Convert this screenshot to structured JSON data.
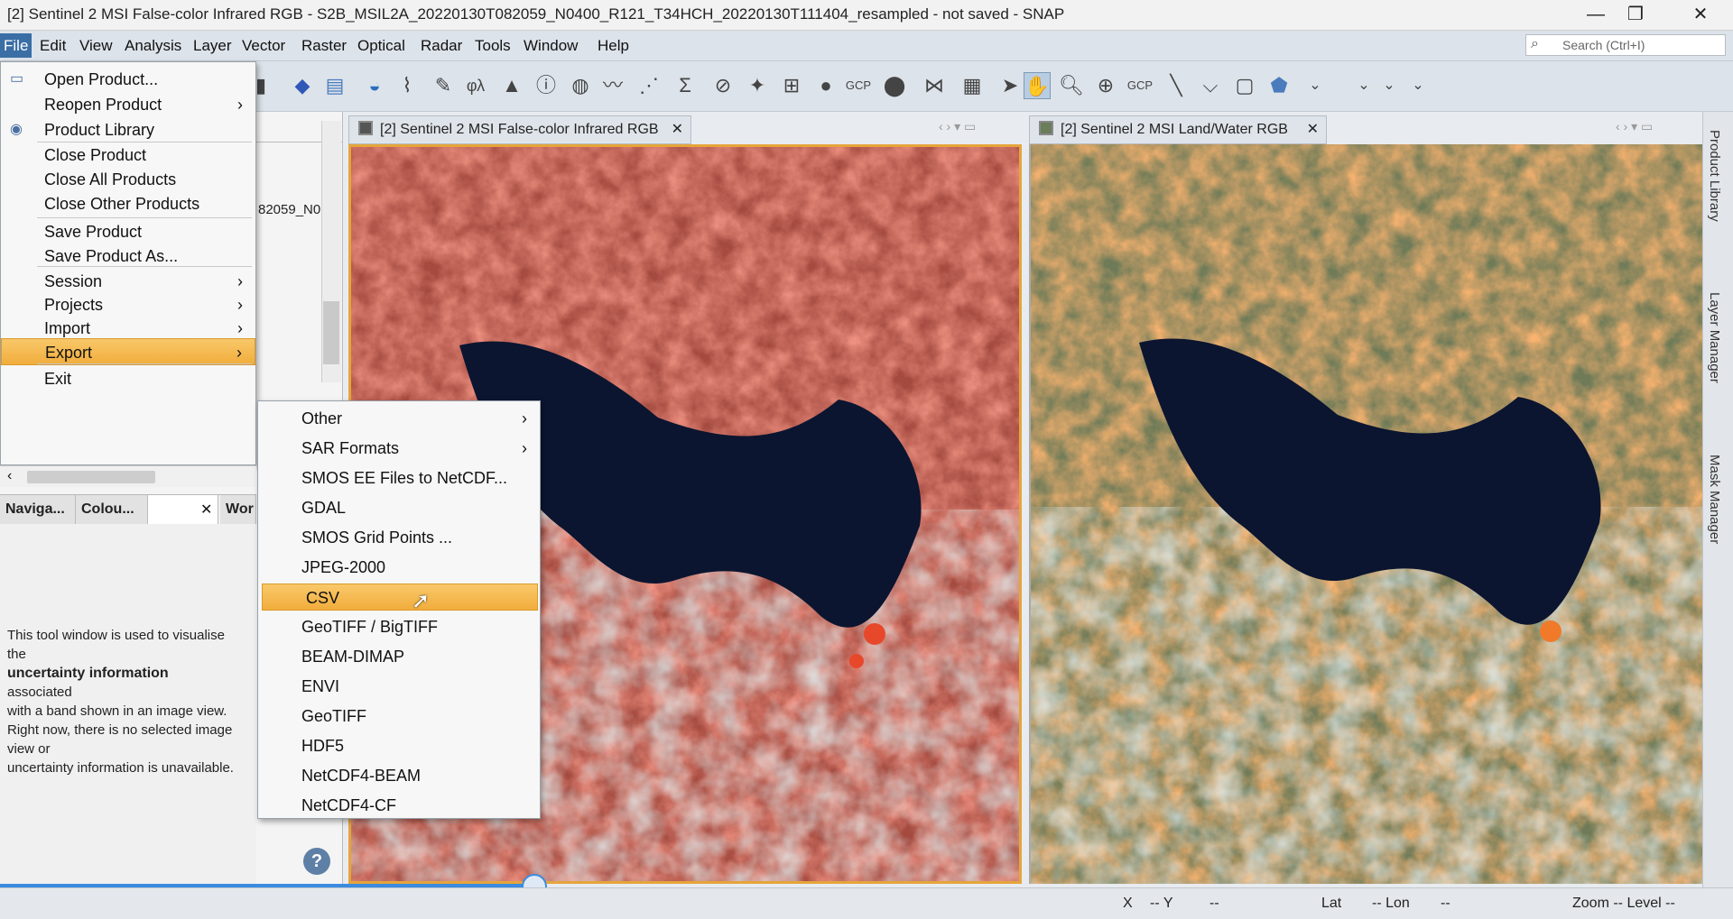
{
  "window": {
    "title": "[2] Sentinel 2 MSI False-color Infrared RGB - S2B_MSIL2A_20220130T082059_N0400_R121_T34HCH_20220130T111404_resampled - not saved - SNAP",
    "minimize": "—",
    "restore": "❐",
    "close": "✕"
  },
  "menubar": [
    "File",
    "Edit",
    "View",
    "Analysis",
    "Layer",
    "Vector",
    "Raster",
    "Optical",
    "Radar",
    "Tools",
    "Window",
    "Help"
  ],
  "search": {
    "placeholder": "Search (Ctrl+I)"
  },
  "toolbar": {
    "icons": [
      "open-product-icon",
      "save-icon",
      "rgb-icon",
      "layer-icon",
      "wave-icon",
      "vector-draw-icon",
      "pencil-icon",
      "spectrum-icon",
      "histogram-icon",
      "information-icon",
      "globe-icon",
      "plot-icon",
      "scatter-icon",
      "sum-icon",
      "crop-icon",
      "magic-icon",
      "grid-icon",
      "mask-icon",
      "gcp-icon",
      "pin-icon",
      "graph-icon",
      "matrix-icon",
      "select-icon",
      "pan-icon",
      "zoom-icon",
      "zoom-plus-icon",
      "gcp-plus-icon",
      "line-icon",
      "polyline-icon",
      "rectangle-icon",
      "shape-icon"
    ],
    "gcp_text": "GCP"
  },
  "left_panel": {
    "product_fragment": "82059_N0",
    "tabs": [
      "Naviga...",
      "Colou...",
      "Wor"
    ],
    "uncertainty_text": [
      {
        "text": "This tool window is used to visualise",
        "bold": false
      },
      {
        "text": "the",
        "bold": false
      },
      {
        "text": "uncertainty information",
        "bold": true
      },
      {
        "text": "associated",
        "bold": false
      },
      {
        "text": "with a band shown in an image view.",
        "bold": false
      },
      {
        "text": "Right now, there is no selected image",
        "bold": false
      },
      {
        "text": "view or",
        "bold": false
      },
      {
        "text": "uncertainty information is unavailable.",
        "bold": false
      }
    ],
    "help": "?"
  },
  "file_menu": {
    "items": [
      {
        "label": "Open Product...",
        "submenu": false,
        "icon": "folder-icon"
      },
      {
        "label": "Reopen Product",
        "submenu": true
      },
      {
        "label": "Product Library",
        "submenu": false,
        "icon": "library-icon"
      },
      {
        "label": "Close Product",
        "submenu": false
      },
      {
        "label": "Close All Products",
        "submenu": false
      },
      {
        "label": "Close Other Products",
        "submenu": false
      },
      {
        "label": "Save Product",
        "submenu": false
      },
      {
        "label": "Save Product As...",
        "submenu": false
      },
      {
        "label": "Session",
        "submenu": true
      },
      {
        "label": "Projects",
        "submenu": true
      },
      {
        "label": "Import",
        "submenu": true
      },
      {
        "label": "Export",
        "submenu": true,
        "highlighted": true
      },
      {
        "label": "Exit",
        "submenu": false
      }
    ]
  },
  "export_menu": {
    "items": [
      {
        "label": "Other",
        "submenu": true
      },
      {
        "label": "SAR Formats",
        "submenu": true
      },
      {
        "label": "SMOS EE Files to NetCDF...",
        "submenu": false
      },
      {
        "label": "GDAL",
        "submenu": false
      },
      {
        "label": "SMOS Grid Points ...",
        "submenu": false
      },
      {
        "label": "JPEG-2000",
        "submenu": false
      },
      {
        "label": "CSV",
        "submenu": false,
        "highlighted": true
      },
      {
        "label": "GeoTIFF / BigTIFF",
        "submenu": false
      },
      {
        "label": "BEAM-DIMAP",
        "submenu": false
      },
      {
        "label": "ENVI",
        "submenu": false
      },
      {
        "label": "GeoTIFF",
        "submenu": false
      },
      {
        "label": "HDF5",
        "submenu": false
      },
      {
        "label": "NetCDF4-BEAM",
        "submenu": false
      },
      {
        "label": "NetCDF4-CF",
        "submenu": false
      }
    ]
  },
  "views": [
    {
      "tab": "[2] Sentinel 2 MSI False-color Infrared RGB",
      "close": "✕"
    },
    {
      "tab": "[2] Sentinel 2 MSI Land/Water RGB",
      "close": "✕"
    }
  ],
  "right_sidebar": [
    "Product Library",
    "Layer Manager",
    "Mask Manager"
  ],
  "statusbar": {
    "x": "X",
    "y": "-- Y",
    "y_val": "--",
    "lat": "Lat",
    "lon": "-- Lon",
    "lon_val": "--",
    "zoom": "Zoom -- Level --"
  },
  "colors": {
    "water": "#0b1530",
    "veg_false_color": "#e0442a",
    "veg_landwater": "#f07a2a",
    "bare": "#a9c7cf",
    "highlight": "#f4b84a"
  }
}
